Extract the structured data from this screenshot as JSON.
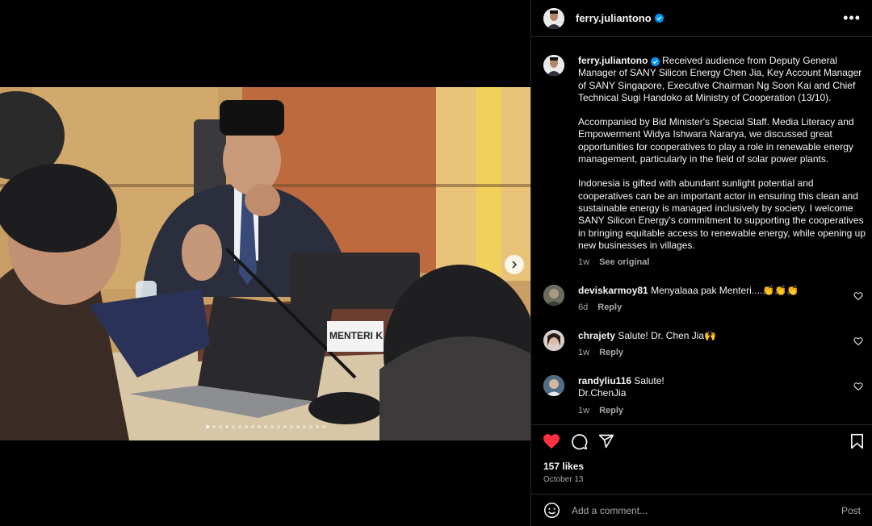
{
  "post": {
    "username": "ferry.juliantono",
    "caption": [
      "Received audience from Deputy General Manager of SANY Silicon Energy Chen Jia, Key Account Manager of SANY Singapore, Executive Chairman Ng Soon Kai and Chief Technical Sugi Handoko at Ministry of Cooperation (13/10).",
      "Accompanied by Bid Minister's Special Staff. Media Literacy and Empowerment Widya Ishwara Nararya, we discussed great opportunities for cooperatives to play a role in renewable energy management, particularly in the field of solar power plants.",
      "Indonesia is gifted with abundant sunlight potential and cooperatives can be an important actor in ensuring this clean and sustainable energy is managed inclusively by society. I welcome SANY Silicon Energy's commitment to supporting the cooperatives in bringing equitable access to renewable energy, while opening up new businesses in villages."
    ],
    "caption_age": "1w",
    "see_original": "See original",
    "likes": "157 likes",
    "date": "October 13",
    "nameplate": "MENTERI K"
  },
  "comments": [
    {
      "username": "deviskarmoy81",
      "text": "Menyalaaa pak Menteri....👏👏👏",
      "age": "6d",
      "reply": "Reply"
    },
    {
      "username": "chrajety",
      "text": "Salute! Dr. Chen Jia🙌",
      "age": "1w",
      "reply": "Reply"
    },
    {
      "username": "randyliu116",
      "text": "Salute!\nDr.ChenJia",
      "age": "1w",
      "reply": "Reply"
    }
  ],
  "comment_box": {
    "placeholder": "Add a comment...",
    "post_label": "Post"
  },
  "colors": {
    "like_red": "#ff3040",
    "verified_blue": "#0095f6",
    "muted": "#a8a8a8"
  },
  "carousel": {
    "total": 19,
    "active": 0
  }
}
